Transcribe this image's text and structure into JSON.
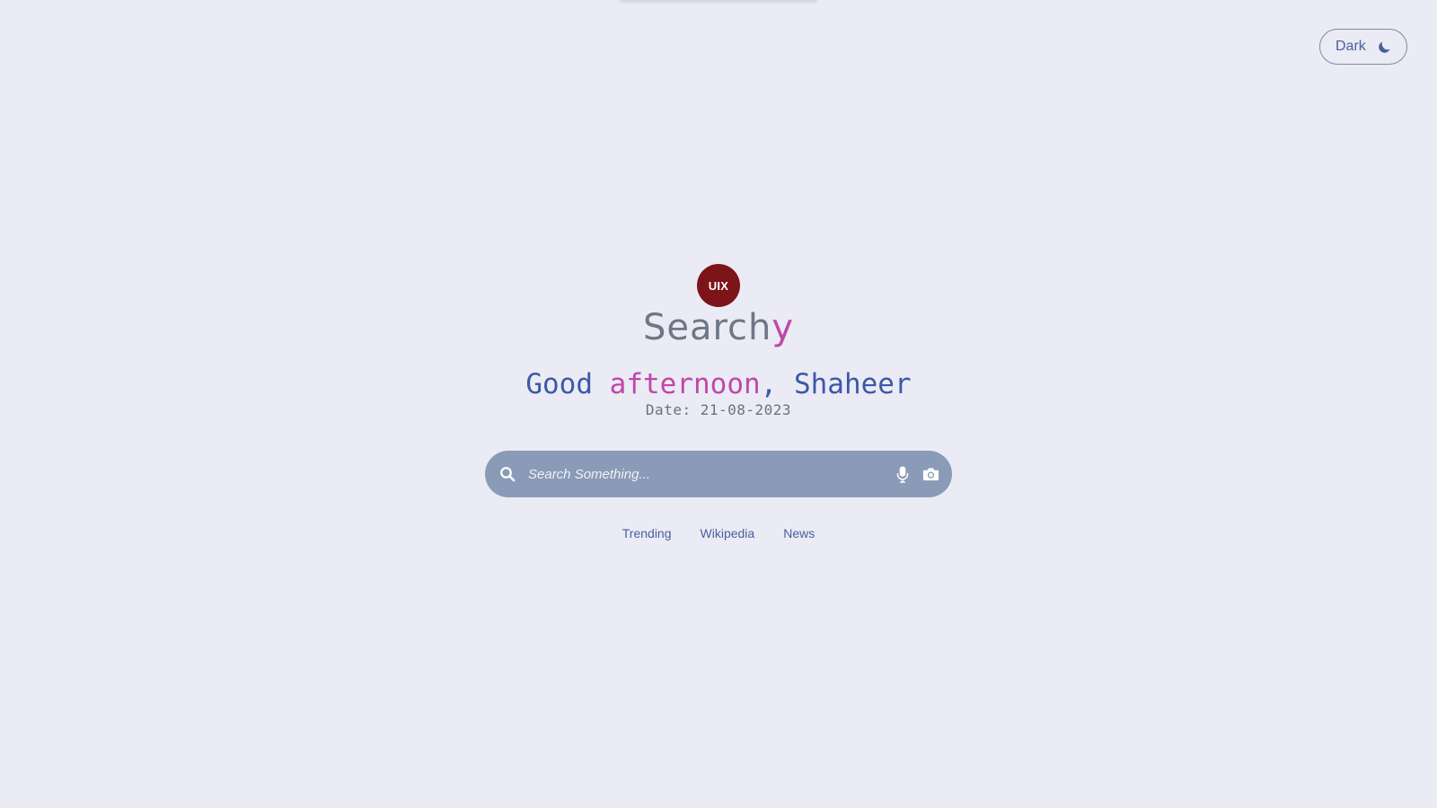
{
  "theme_toggle": {
    "label": "Dark",
    "icon": "moon-icon"
  },
  "logo": {
    "badge_text": "UIX",
    "brand_main": "Search",
    "brand_accent": "y",
    "badge_color": "#7d1419",
    "accent_color": "#c047a8"
  },
  "greeting": {
    "prefix": "Good ",
    "period": "afternoon",
    "separator": ", ",
    "name": "Shaheer"
  },
  "date": {
    "label": "Date:",
    "value": "21-08-2023"
  },
  "search": {
    "placeholder": "Search Something...",
    "value": "",
    "icons": [
      "search-icon",
      "microphone-icon",
      "camera-icon"
    ]
  },
  "quick_links": [
    {
      "label": "Trending"
    },
    {
      "label": "Wikipedia"
    },
    {
      "label": "News"
    }
  ]
}
